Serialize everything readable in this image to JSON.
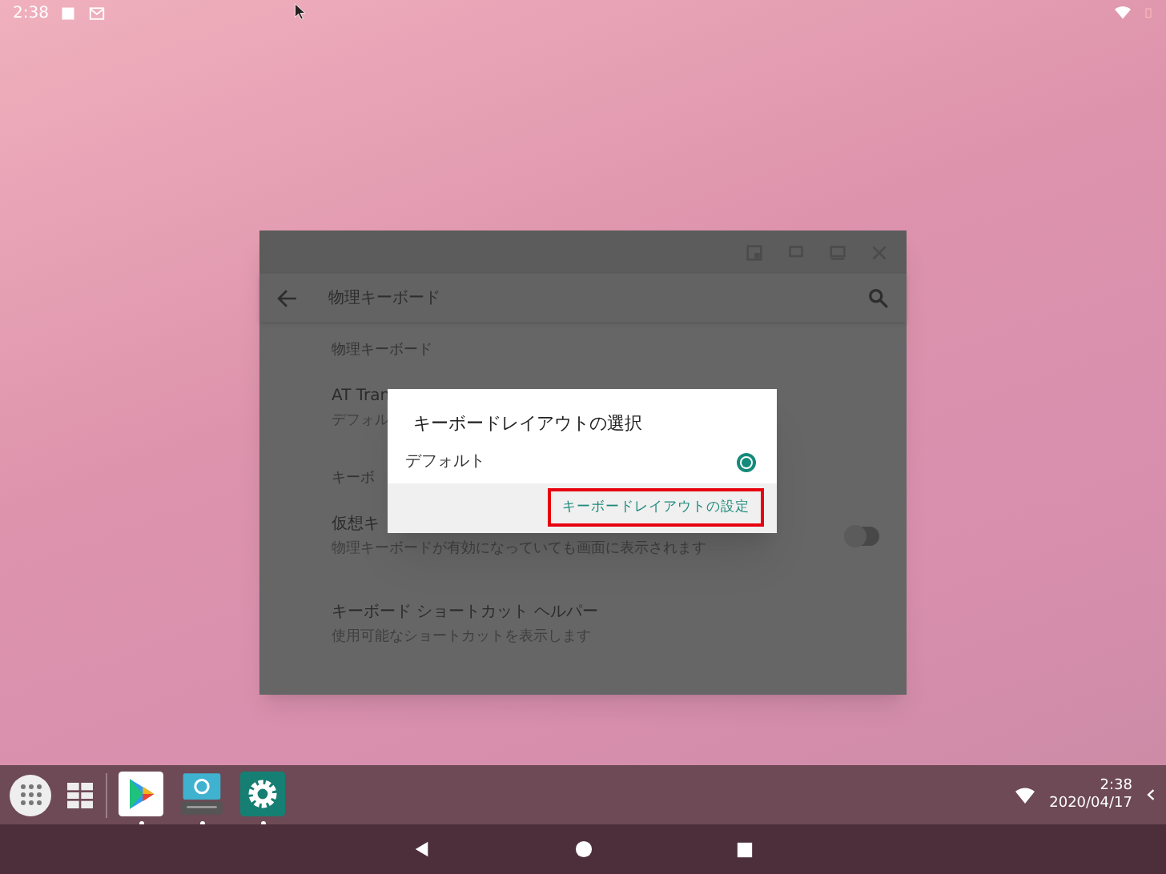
{
  "status_bar": {
    "time": "2:38"
  },
  "window": {
    "toolbar": {
      "title": "物理キーボード"
    },
    "sections": [
      {
        "header": "物理キーボード",
        "rows": [
          {
            "title": "AT Tran",
            "subtitle": "デフォル"
          }
        ]
      },
      {
        "header": "キーボ",
        "rows": [
          {
            "title": "仮想キ",
            "subtitle": "物理キーボードが有効になっていても画面に表示されます",
            "kind": "toggle",
            "on": false
          },
          {
            "title": "キーボード ショートカット ヘルパー",
            "subtitle": "使用可能なショートカットを表示します"
          }
        ]
      }
    ]
  },
  "dialog": {
    "title": "キーボードレイアウトの選択",
    "options": [
      {
        "label": "デフォルト",
        "selected": true
      }
    ],
    "button": {
      "label": "キーボードレイアウトの設定",
      "highlighted": true
    }
  },
  "taskbar": {
    "apps": [
      {
        "kind": "play"
      },
      {
        "kind": "ime"
      },
      {
        "kind": "settings"
      }
    ],
    "time": "2:38",
    "date": "2020/04/17"
  }
}
